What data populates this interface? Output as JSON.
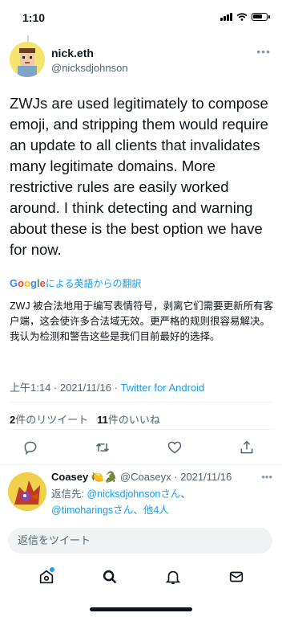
{
  "status_bar": {
    "time": "1:10"
  },
  "tweet": {
    "author_name": "nick.eth",
    "author_handle": "@nicksdjohnson",
    "text": "ZWJs are used legitimately to compose emoji, and stripping them would require an update to all clients that invalidates many legitimate domains. More restrictive rules are easily worked around. I think detecting and warning about these is the best option we have for now.",
    "translate_link": "による英語からの翻訳",
    "translate_brand": "Google",
    "translated_text": "ZWJ 被合法地用于编写表情符号，剥离它们需要更新所有客户端，这会使许多合法域无效。更严格的规则很容易解决。我认为检测和警告这些是我们目前最好的选择。",
    "timestamp": "上午1:14 · 2021/11/16 · ",
    "source": "Twitter for Android",
    "retweets_count": "2",
    "retweets_label": "件のリツイート",
    "likes_count": "11",
    "likes_label": "件のいいね"
  },
  "reply": {
    "author_name": "Coasey",
    "author_emoji": "🍋🐊",
    "author_handle": "@Coaseyx",
    "date": " · 2021/11/16",
    "reply_to_prefix": "返信先: ",
    "mention_1": "@nicksdjohnsonさん",
    "mention_sep": "、",
    "mention_2": "@timoharingsさん",
    "others": "、他4人"
  },
  "compose": {
    "placeholder": "返信をツイート"
  },
  "colors": {
    "link": "#1d9bf0",
    "secondary": "#536471",
    "text": "#0f1419"
  },
  "icons": {
    "actions": [
      "reply-icon",
      "retweet-icon",
      "like-icon",
      "share-icon"
    ],
    "tabs": [
      "home-icon",
      "search-icon",
      "notifications-icon",
      "messages-icon"
    ]
  }
}
